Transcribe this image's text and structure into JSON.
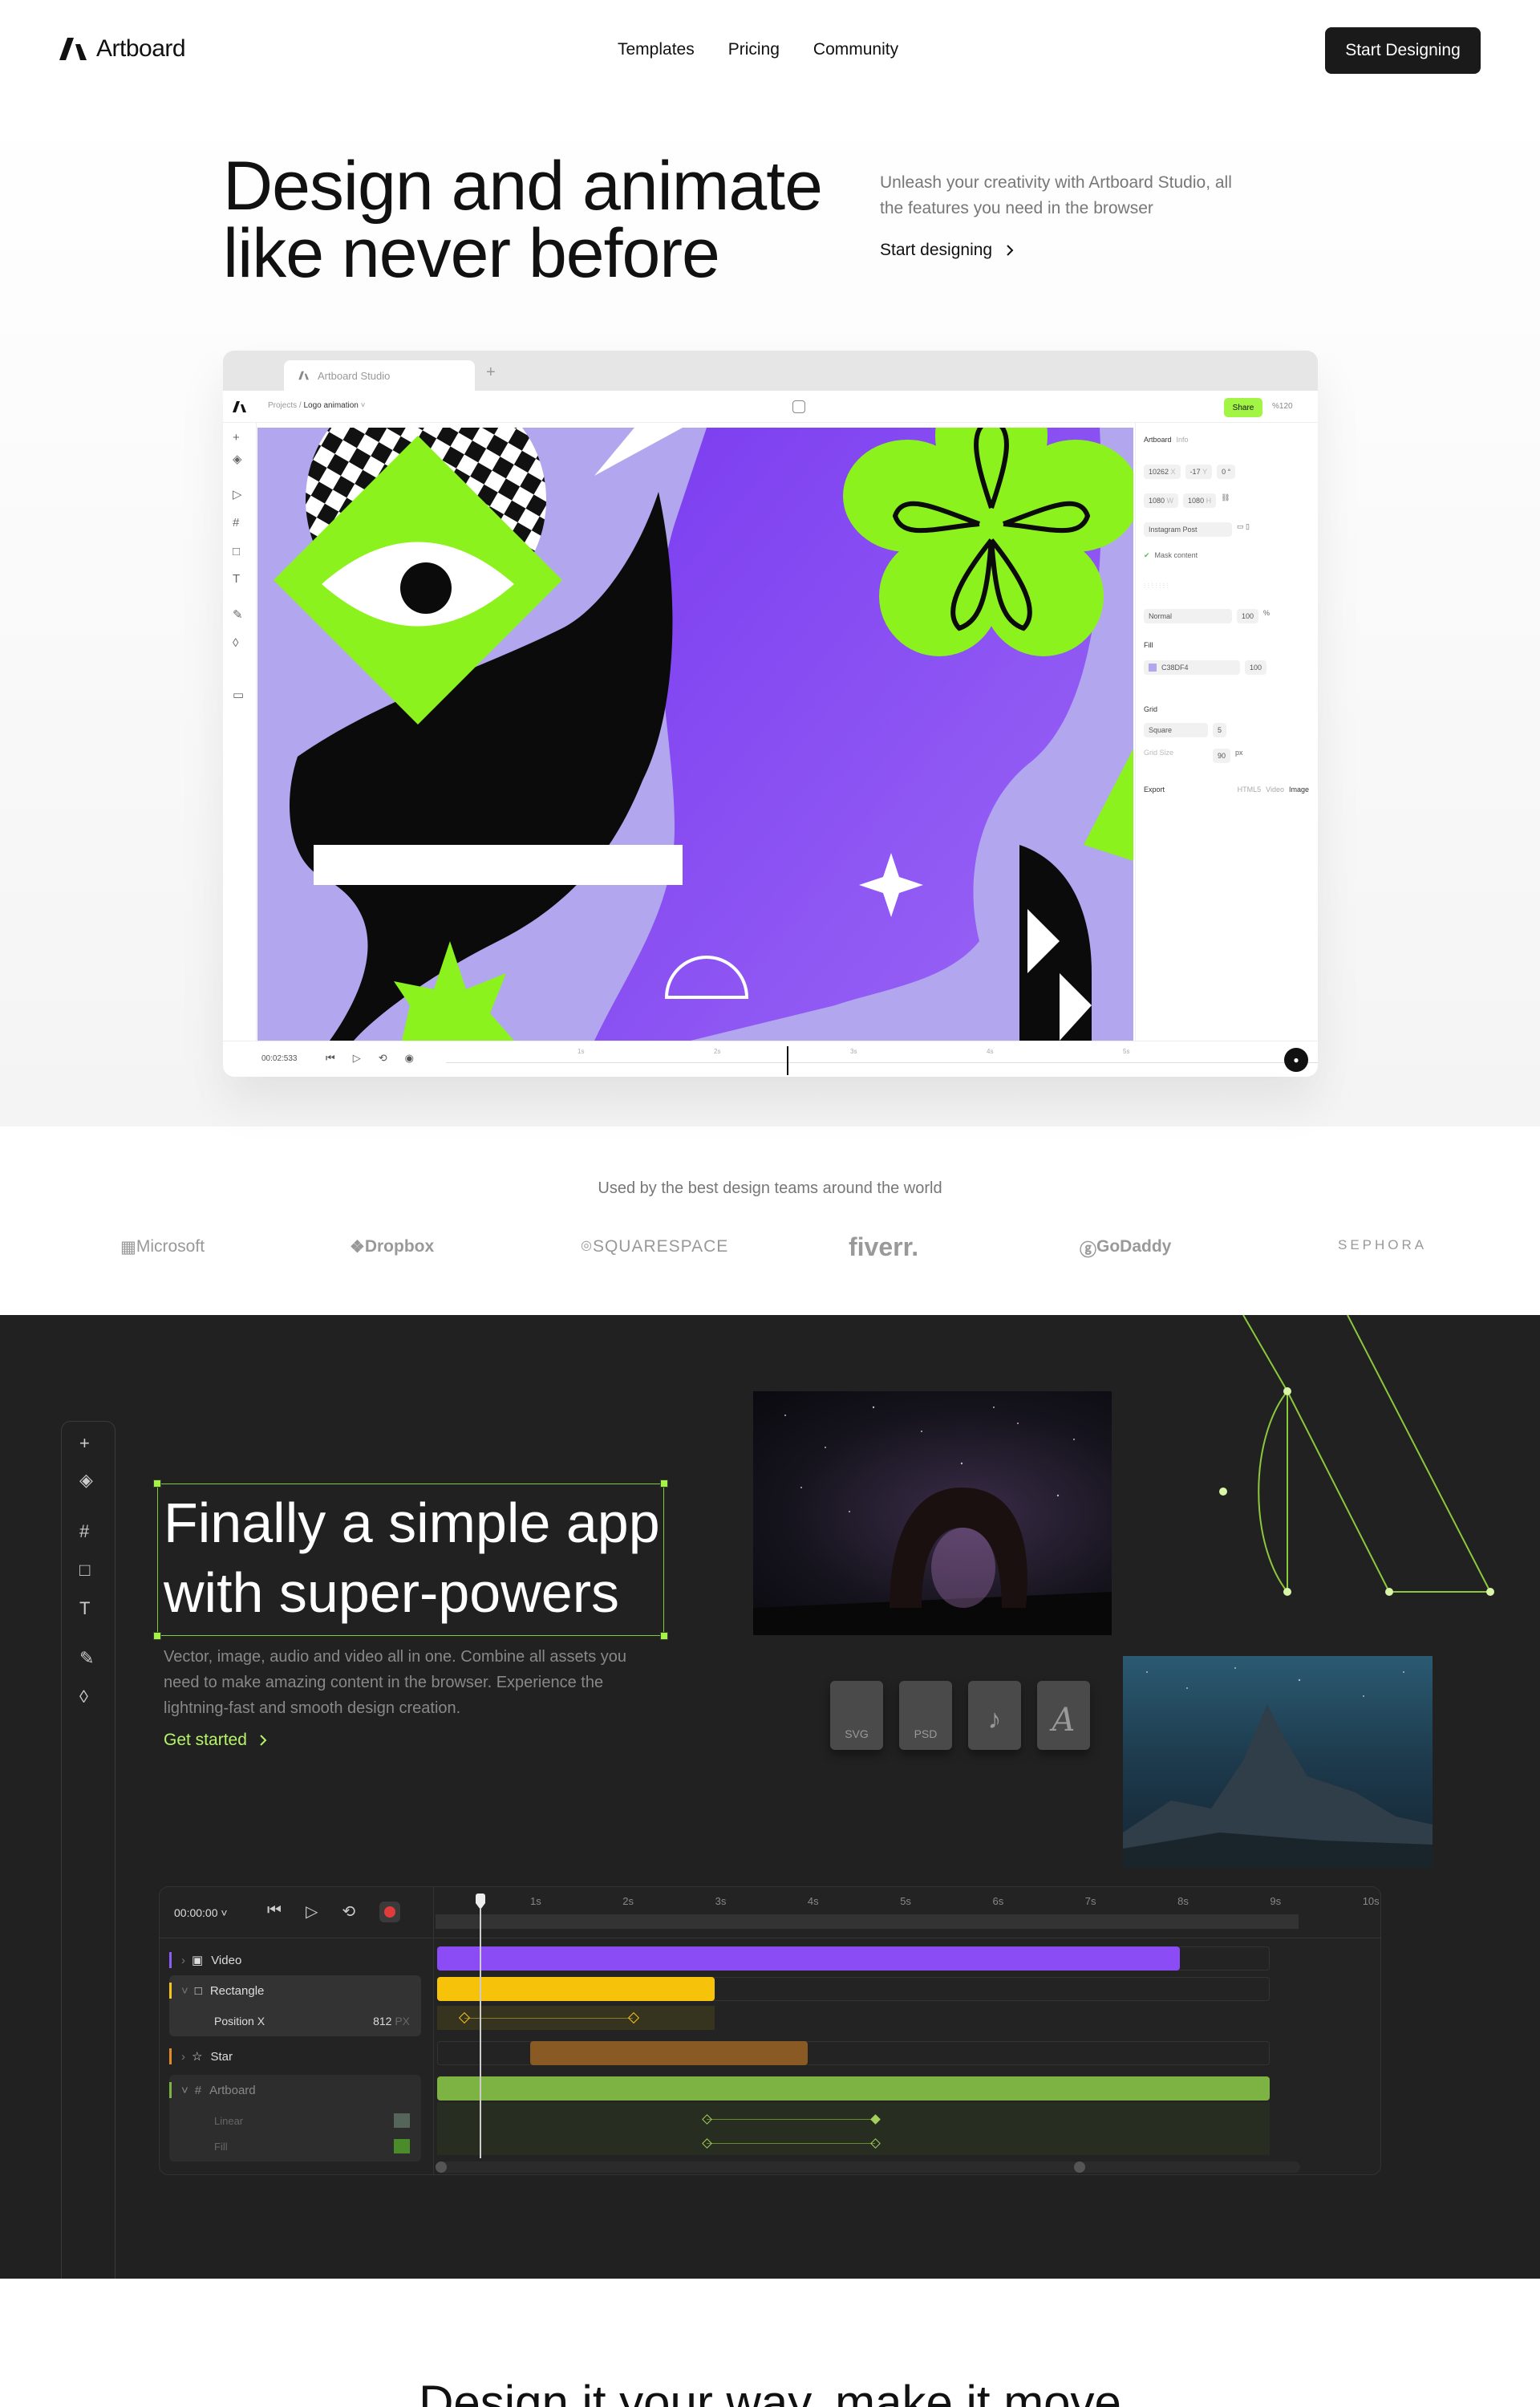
{
  "nav": {
    "brand": "Artboard",
    "links": [
      "Templates",
      "Pricing",
      "Community"
    ],
    "cta": "Start Designing"
  },
  "hero": {
    "title_line1": "Design and animate",
    "title_line2": "like never before",
    "subtitle": "Unleash your creativity with Artboard Studio, all the features you need in the browser",
    "link": "Start designing"
  },
  "app": {
    "tab_title": "Artboard Studio",
    "breadcrumb_root": "Projects /",
    "breadcrumb_current": "Logo animation",
    "share": "Share",
    "zoom": "%120",
    "panel": {
      "tabs": [
        "Artboard",
        "Info"
      ],
      "x": "10262",
      "x_label": "X",
      "y": "-17",
      "y_label": "Y",
      "rotation": "0",
      "w": "1080",
      "w_label": "W",
      "h": "1080",
      "h_label": "H",
      "preset": "Instagram Post",
      "mask": "Mask content",
      "blend": "Normal",
      "opacity": "100",
      "pct": "%",
      "fill_label": "Fill",
      "fill_hex": "C38DF4",
      "fill_opacity": "100",
      "grid_label": "Grid",
      "grid_type": "Square",
      "grid_count": "5",
      "grid_size_label": "Grid Size",
      "grid_size": "90",
      "grid_unit": "px",
      "export_label": "Export",
      "export_opts": [
        "HTML5",
        "Video",
        "Image"
      ]
    },
    "timecode": "00:02:533",
    "ticks": [
      "1s",
      "2s",
      "3s",
      "4s",
      "5s"
    ]
  },
  "logos": {
    "caption": "Used by the best design teams around the world",
    "items": [
      "Microsoft",
      "Dropbox",
      "SQUARESPACE",
      "fiverr.",
      "GoDaddy",
      "SEPHORA"
    ]
  },
  "dark": {
    "title_line1": "Finally a simple app",
    "title_line2": "with super-powers",
    "paragraph": "Vector, image, audio and video all in one. Combine all assets you need to make amazing content in the browser. Experience the lightning-fast and smooth design creation.",
    "link": "Get started",
    "file_icons": [
      "SVG",
      "PSD",
      "♪",
      "A"
    ]
  },
  "timeline": {
    "timecode": "00:00:00",
    "ticks": [
      "1s",
      "2s",
      "3s",
      "4s",
      "5s",
      "6s",
      "7s",
      "8s",
      "9s",
      "10s"
    ],
    "layers": [
      {
        "name": "Video",
        "color": "#8b5cf6"
      },
      {
        "name": "Rectangle",
        "color": "#f5c518"
      },
      {
        "name": "Position X",
        "value": "812",
        "unit": "PX"
      },
      {
        "name": "Star",
        "color": "#e08a2c"
      },
      {
        "name": "Artboard",
        "color": "#7cb342"
      },
      {
        "name": "Linear"
      },
      {
        "name": "Fill"
      }
    ]
  },
  "footer": {
    "heading": "Design it your way, make it move"
  },
  "colors": {
    "accent_green": "#a2f544",
    "purple": "#8b4cf5",
    "lavender": "#b2a6ee",
    "dark_bg": "#212121"
  }
}
